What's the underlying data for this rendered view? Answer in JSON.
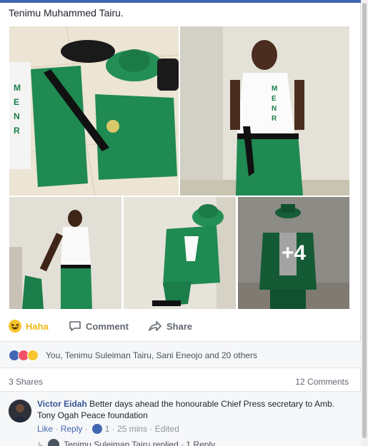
{
  "post": {
    "text": "Tenimu Muhammed Tairu.",
    "more_photos": "+4"
  },
  "actions": {
    "haha": "Haha",
    "comment": "Comment",
    "share": "Share"
  },
  "reactions": {
    "names": "You, Tenimu Suleiman Tairu, Sani Eneojo and 20 others"
  },
  "stats": {
    "shares": "3 Shares",
    "comments": "12 Comments"
  },
  "comment": {
    "author": "Victor Eidah",
    "text": "Better days ahead the honourable Chief Press secretary to Amb. Tony Ogah Peace foundation",
    "like": "Like",
    "reply": "Reply",
    "like_count": "1",
    "time": "25 mins",
    "edited": "Edited",
    "reply_summary": "Tenimu Suleiman Tairu replied",
    "reply_count": "1 Reply"
  },
  "colors": {
    "facebook_blue": "#4267b2",
    "haha_yellow": "#f0ba15",
    "uniform_green": "#1a7d4a"
  }
}
